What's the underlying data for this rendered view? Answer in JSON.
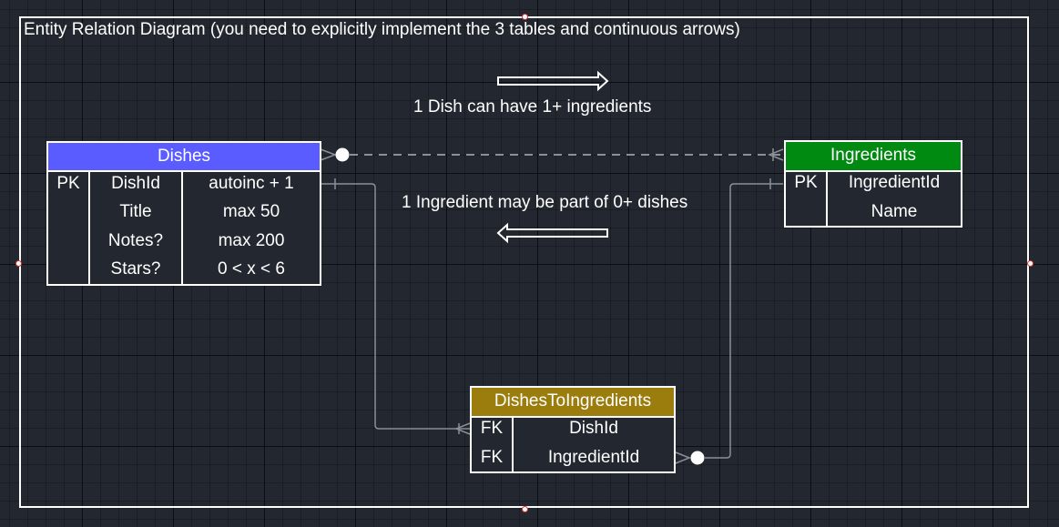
{
  "diagram_title": "Entity Relation Diagram (you need to explicitly implement the 3 tables and continuous arrows)",
  "notes": {
    "dish_has_ingredients": "1 Dish can have 1+ ingredients",
    "ingredient_in_dishes": "1 Ingredient may be part of 0+ dishes"
  },
  "colors": {
    "dishes_header": "#5a5cff",
    "ingredients_header": "#008a12",
    "join_header": "#9a7d0c",
    "background": "#232830",
    "connector": "#8a8f98"
  },
  "tables": {
    "dishes": {
      "name": "Dishes",
      "rows": [
        {
          "key": "PK",
          "field": "DishId",
          "constraint": "autoinc + 1"
        },
        {
          "key": "",
          "field": "Title",
          "constraint": "max 50"
        },
        {
          "key": "",
          "field": "Notes?",
          "constraint": "max 200"
        },
        {
          "key": "",
          "field": "Stars?",
          "constraint": "0 < x < 6"
        }
      ]
    },
    "ingredients": {
      "name": "Ingredients",
      "rows": [
        {
          "key": "PK",
          "field": "IngredientId"
        },
        {
          "key": "",
          "field": "Name"
        }
      ]
    },
    "dishes_to_ingredients": {
      "name": "DishesToIngredients",
      "rows": [
        {
          "key": "FK",
          "field": "DishId"
        },
        {
          "key": "FK",
          "field": "IngredientId"
        }
      ]
    }
  },
  "arrows": {
    "right": "right-arrow-icon",
    "left": "left-arrow-icon"
  }
}
